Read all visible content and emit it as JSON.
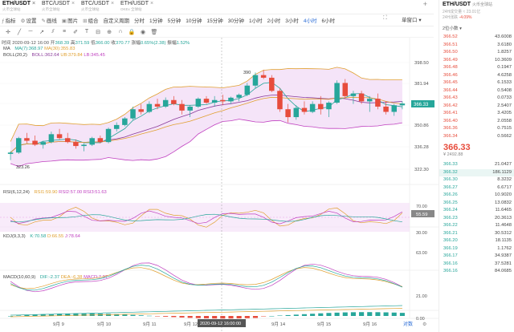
{
  "tabs": [
    {
      "symbol": "ETH/USDT",
      "sub": "火币全球站",
      "active": true
    },
    {
      "symbol": "BTC/USDT",
      "sub": "火币全球站",
      "active": false
    },
    {
      "symbol": "BTC/USDT",
      "sub": "火币全球站",
      "active": false
    },
    {
      "symbol": "ETH/USDT",
      "sub": "OKEx 全球站",
      "active": false
    }
  ],
  "toolbar": {
    "items": [
      "指标",
      "设置",
      "画线",
      "图片",
      "组合",
      "自定义周期",
      "分时",
      "1分钟",
      "5分钟",
      "10分钟",
      "15分钟",
      "30分钟",
      "1小时",
      "2小时",
      "3小时",
      "4小时",
      "6小时"
    ],
    "active": "4小时",
    "view": "单窗口"
  },
  "info": {
    "time_label": "时间",
    "time": "2020-09-12 16:00",
    "open_label": "开",
    "open": "368.39",
    "high_label": "高",
    "high": "371.59",
    "low_label": "低",
    "low": "366.00",
    "close_label": "收",
    "close": "370.77",
    "chg_label": "涨幅",
    "chg": "0.65%(2.38)",
    "amp_label": "振幅",
    "amp": "1.52%"
  },
  "ma": {
    "name": "MA",
    "ma7": "MA(7):368.97",
    "ma30": "MA(30):355.83"
  },
  "boll": {
    "name": "BOLL(20,2)",
    "boll": "BOLL:362.64",
    "ub": "UB:379.84",
    "lb": "LB:345.45"
  },
  "rsi": {
    "name": "RSI(6,12,24)",
    "rsi1": "RSI1:59.90",
    "rsi2": "RSI2:57.00",
    "rsi3": "RSI3:51.63",
    "last": "55.59"
  },
  "kdj": {
    "name": "KDJ(9,3,3)",
    "k": "K:70.58",
    "d": "D:66.55",
    "j": "J:78.64"
  },
  "macd": {
    "name": "MACD(10,60,9)",
    "dif": "DIF:-2.37",
    "dea": "DEA:-6.38",
    "macd": "MACD:7.97"
  },
  "price_axis": [
    "398.50",
    "381.94",
    "366.33",
    "350.86",
    "336.28",
    "322.30"
  ],
  "last_price_tag": "366.33",
  "rsi_axis": [
    "70.00",
    "50.00",
    "30.00"
  ],
  "kdj_axis": [
    "63.00",
    "21.00"
  ],
  "macd_axis": [
    "0.00"
  ],
  "annotations": {
    "high": "390",
    "low": "323.26"
  },
  "dates": [
    "9月 9",
    "9月 10",
    "9月 11",
    "9月 12",
    "9月 14",
    "9月 15",
    "9月 16"
  ],
  "crosshair_date": "2020-09-12 16:00:00",
  "log_label": "对数",
  "panel": {
    "symbol": "ETH/USDT",
    "exchange": "火币全球站",
    "vol": "24H成交量 ≈ 23.01亿",
    "chg_label": "24H涨跌",
    "chg": "-4.09%",
    "step": "2位小数",
    "asks": [
      [
        "366.52",
        "43.6008"
      ],
      [
        "366.51",
        "3.6180"
      ],
      [
        "366.50",
        "1.8257"
      ],
      [
        "366.49",
        "10.3609"
      ],
      [
        "366.48",
        "0.1947"
      ],
      [
        "366.46",
        "4.6258"
      ],
      [
        "366.45",
        "6.1533"
      ],
      [
        "366.44",
        "0.5408"
      ],
      [
        "366.43",
        "0.0733"
      ],
      [
        "366.42",
        "2.5407"
      ],
      [
        "366.41",
        "3.4205"
      ],
      [
        "366.40",
        "2.0558"
      ],
      [
        "366.36",
        "0.7515"
      ],
      [
        "366.34",
        "0.5662"
      ]
    ],
    "last_price": "366.33",
    "last_sub": "¥ 2492.88",
    "bids": [
      [
        "366.33",
        "21.0427"
      ],
      [
        "366.32",
        "186.1129"
      ],
      [
        "366.30",
        "8.3232"
      ],
      [
        "366.27",
        "6.6717"
      ],
      [
        "366.26",
        "10.9020"
      ],
      [
        "366.25",
        "13.0832"
      ],
      [
        "366.24",
        "11.6465"
      ],
      [
        "366.23",
        "20.3613"
      ],
      [
        "366.22",
        "11.4648"
      ],
      [
        "366.21",
        "30.5312"
      ],
      [
        "366.20",
        "18.1135"
      ],
      [
        "366.19",
        "1.1762"
      ],
      [
        "366.17",
        "34.9387"
      ],
      [
        "366.16",
        "37.5281"
      ],
      [
        "366.16",
        "84.0685"
      ]
    ]
  },
  "colors": {
    "up": "#26a69a",
    "down": "#e74c3c",
    "boll_fill": "#f3ddf6",
    "accent": "#2a6cd6"
  },
  "chart_data": {
    "type": "candlestick",
    "candles_ohlc": [
      [
        328,
        330,
        323.3,
        329
      ],
      [
        329,
        341,
        328,
        340
      ],
      [
        340,
        344,
        336,
        338
      ],
      [
        338,
        342,
        334,
        335
      ],
      [
        335,
        338,
        332,
        337
      ],
      [
        337,
        345,
        336,
        343
      ],
      [
        343,
        347,
        339,
        340
      ],
      [
        340,
        344,
        336,
        337
      ],
      [
        337,
        339,
        332,
        334
      ],
      [
        334,
        336,
        330,
        335
      ],
      [
        335,
        341,
        334,
        340
      ],
      [
        340,
        342,
        336,
        337
      ],
      [
        337,
        348,
        336,
        347
      ],
      [
        347,
        352,
        345,
        350
      ],
      [
        350,
        356,
        349,
        355
      ],
      [
        355,
        364,
        354,
        362
      ],
      [
        362,
        366,
        358,
        360
      ],
      [
        360,
        368,
        359,
        366
      ],
      [
        366,
        370,
        362,
        364
      ],
      [
        364,
        371,
        363,
        369
      ],
      [
        369,
        372,
        365,
        366
      ],
      [
        366,
        369,
        358,
        361
      ],
      [
        361,
        365,
        356,
        364
      ],
      [
        364,
        371,
        363,
        370
      ],
      [
        370,
        372,
        366,
        367
      ],
      [
        367,
        372,
        364,
        369
      ],
      [
        369,
        373,
        365,
        368
      ],
      [
        368,
        371.6,
        366,
        370.8
      ],
      [
        370.8,
        374,
        368,
        373
      ],
      [
        373,
        382,
        372,
        380
      ],
      [
        380,
        390,
        378,
        388
      ],
      [
        388,
        392,
        385,
        386
      ],
      [
        386,
        388,
        375,
        376
      ],
      [
        376,
        378,
        360,
        362
      ],
      [
        362,
        366,
        352,
        356
      ],
      [
        356,
        365,
        354,
        363
      ],
      [
        363,
        368,
        358,
        360
      ],
      [
        360,
        368,
        359,
        366
      ],
      [
        366,
        372,
        358,
        362
      ],
      [
        362,
        368,
        356,
        367
      ],
      [
        367,
        384,
        366,
        382
      ],
      [
        382,
        385,
        370,
        372
      ],
      [
        372,
        376,
        366,
        374
      ],
      [
        374,
        376,
        366,
        368
      ],
      [
        368,
        372,
        360,
        370
      ],
      [
        370,
        374,
        362,
        364
      ],
      [
        364,
        368,
        358,
        360
      ],
      [
        360,
        366,
        357,
        365
      ],
      [
        365,
        368,
        362,
        366.33
      ]
    ]
  }
}
